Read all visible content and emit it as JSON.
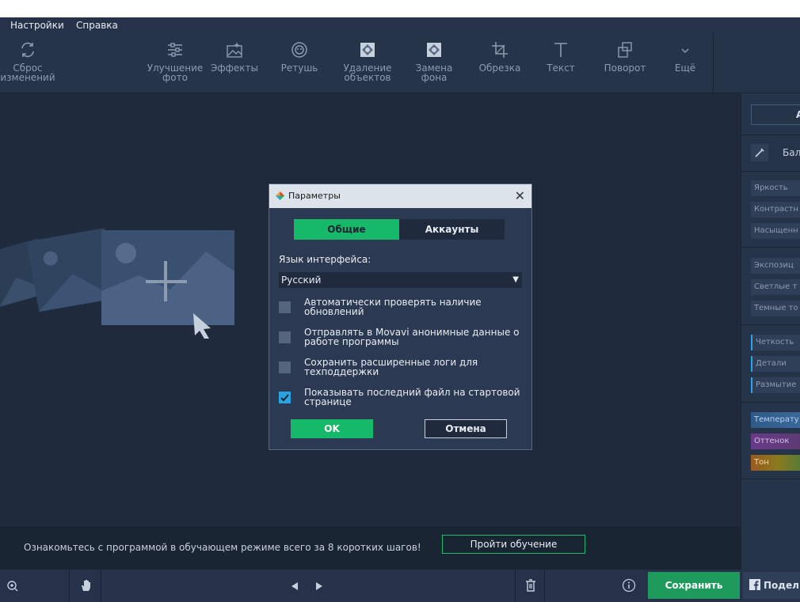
{
  "menu": {
    "items": [
      "Настройки",
      "Справка"
    ]
  },
  "toolbar": {
    "tools": [
      {
        "label": "Сброс\nизменений",
        "icon": "reset-icon"
      },
      {
        "label": "Улучшение\nфото",
        "icon": "sliders-icon"
      },
      {
        "label": "Эффекты",
        "icon": "effects-icon"
      },
      {
        "label": "Ретушь",
        "icon": "retouch-icon"
      },
      {
        "label": "Удаление\nобъектов",
        "icon": "object-removal-icon"
      },
      {
        "label": "Замена\nфона",
        "icon": "background-change-icon"
      },
      {
        "label": "Обрезка",
        "icon": "crop-icon"
      },
      {
        "label": "Текст",
        "icon": "text-icon"
      },
      {
        "label": "Поворот",
        "icon": "rotate-icon"
      },
      {
        "label": "Ещё",
        "icon": "chevron-down-icon"
      }
    ]
  },
  "tutorial": {
    "text": "Ознакомьтесь с программой в обучающем режиме всего за 8 коротких шагов!",
    "button": "Пройти обучение"
  },
  "bottombar": {
    "save": "Сохранить",
    "share": "Подел"
  },
  "rightpanel": {
    "auto": "А",
    "balance": "Бал",
    "group1": [
      "Яркость",
      "Контрастн",
      "Насыщенн"
    ],
    "group2": [
      "Экспозиц",
      "Светлые т",
      "Темные то"
    ],
    "group3": [
      "Четкость",
      "Детали",
      "Размытие"
    ],
    "group4": [
      "Температу",
      "Оттенок",
      "Тон"
    ]
  },
  "dialog": {
    "title": "Параметры",
    "tabs": [
      "Общие",
      "Аккаунты"
    ],
    "language_label": "Язык интерфейса:",
    "language_value": "Русский",
    "options": [
      {
        "text": "Автоматически проверять наличие обновлений",
        "checked": false
      },
      {
        "text": "Отправлять в Movavi анонимные данные о работе программы",
        "checked": false
      },
      {
        "text": "Сохранить расширенные логи для техподдержки",
        "checked": false
      },
      {
        "text": "Показывать последний файл на стартовой странице",
        "checked": true
      }
    ],
    "ok": "OK",
    "cancel": "Отмена"
  },
  "colors": {
    "background": "#1f2b3c",
    "accent_green": "#16b96a",
    "checkbox_checked": "#2aa3e0"
  }
}
